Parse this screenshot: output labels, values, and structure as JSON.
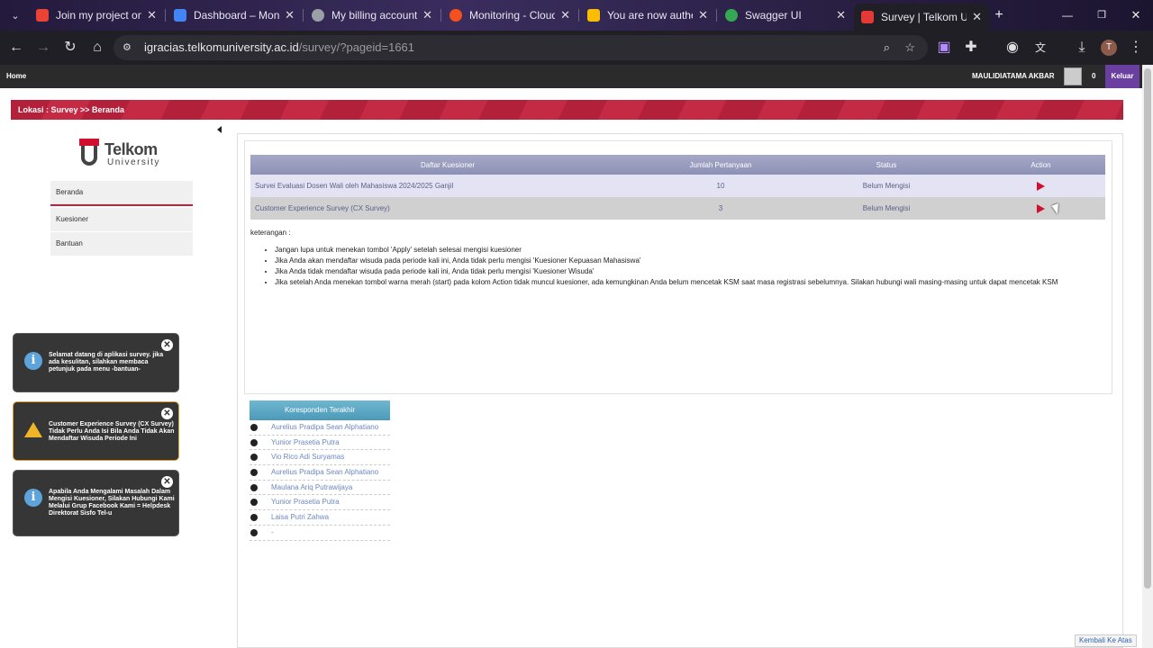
{
  "browser": {
    "tabs": [
      {
        "title": "Join my project on G",
        "color": "#ea4335"
      },
      {
        "title": "Dashboard – Monito",
        "color": "#4285f4"
      },
      {
        "title": "My billing accounts",
        "color": "#9aa0a6"
      },
      {
        "title": "Monitoring - Cloud T",
        "color": "#f4511e"
      },
      {
        "title": "You are now authent",
        "color": "#fbbc04"
      },
      {
        "title": "Swagger UI",
        "color": "#34a853"
      },
      {
        "title": "Survey | Telkom Univ",
        "color": "#e53935"
      }
    ],
    "url_host": "igracias.telkomuniversity.ac.id",
    "url_path": "/survey/?pageid=1661",
    "profile_initial": "T"
  },
  "site": {
    "home_label": "Home",
    "user_name": "MAULIDIATAMA AKBAR",
    "notif_count": "0",
    "logout_label": "Keluar",
    "breadcrumb": "Lokasi : Survey >> Beranda",
    "logo_line1": "Telkom",
    "logo_line2": "University",
    "back_to_top": "Kembali Ke Atas"
  },
  "sidebar": {
    "items": [
      {
        "label": "Beranda"
      },
      {
        "label": "Kuesioner"
      },
      {
        "label": "Bantuan"
      }
    ]
  },
  "table": {
    "headers": [
      "Daftar Kuesioner",
      "Jumlah Pertanyaan",
      "Status",
      "Action"
    ],
    "rows": [
      {
        "name": "Survei Evaluasi Dosen Wali oleh Mahasiswa 2024/2025 Ganjil",
        "count": "10",
        "status": "Belum Mengisi"
      },
      {
        "name": "Customer Experience Survey (CX Survey)",
        "count": "3",
        "status": "Belum Mengisi"
      }
    ]
  },
  "notes": {
    "title": "keterangan :",
    "items": [
      "Jangan lupa untuk menekan tombol 'Apply' setelah selesai mengisi kuesioner",
      "Jika Anda akan mendaftar wisuda pada periode kali ini, Anda tidak perlu mengisi 'Kuesioner Kepuasan Mahasiswa'",
      "Jika Anda tidak mendaftar wisuda pada periode kali ini, Anda tidak perlu mengisi 'Kuesioner Wisuda'",
      "Jika setelah Anda menekan tombol warna merah (start) pada kolom Action tidak muncul kuesioner, ada kemungkinan Anda belum mencetak KSM saat masa registrasi sebelumnya. Silakan hubungi wali masing-masing untuk dapat mencetak KSM"
    ]
  },
  "toasts": [
    {
      "type": "info",
      "text": "Selamat datang di aplikasi survey. jika ada kesulitan, silahkan membaca petunjuk pada menu -bantuan-"
    },
    {
      "type": "warning",
      "text": "Customer Experience Survey (CX Survey) Tidak Perlu Anda Isi Bila Anda Tidak Akan Mendaftar Wisuda Periode Ini"
    },
    {
      "type": "info",
      "text": "Apabila Anda Mengalami Masalah Dalam Mengisi Kuesioner, Silakan Hubungi Kami Melalui Grup Facebook Kami = Helpdesk Direktorat Sisfo Tel-u"
    }
  ],
  "koresponden": {
    "title": "Koresponden Terakhir",
    "names": [
      "Aurelius Pradipa Sean Alphatiano",
      "Yunior Prasetia Putra",
      "Vio Rico Adi Suryamas",
      "Aurelius Pradipa Sean Alphatiano",
      "Maulana Ariq Putrawijaya",
      "Yunior Prasetia Putra",
      "Laisa Putri Zahwa",
      "-"
    ]
  }
}
